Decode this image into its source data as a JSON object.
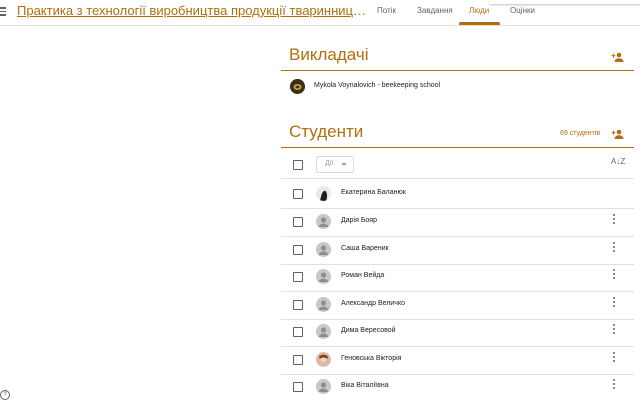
{
  "header": {
    "course_title": "Практика з технології виробництва продукції тваринництва (бджільництво)",
    "tabs": [
      {
        "label": "Потік"
      },
      {
        "label": "Завдання"
      },
      {
        "label": "Люди"
      },
      {
        "label": "Оцінки"
      }
    ],
    "active_tab": "Люди"
  },
  "teachers": {
    "title": "Викладачі",
    "items": [
      {
        "name": "Mykola Voynalovich - beekeeping school"
      }
    ]
  },
  "students": {
    "title": "Студенти",
    "count_label": "69 студентів",
    "actions_label": "Дії",
    "items": [
      {
        "name": "Екатерина Баланюк",
        "avatar": "photo-dark"
      },
      {
        "name": "Дарія Бояр",
        "avatar": "default"
      },
      {
        "name": "Саша Вареник",
        "avatar": "default"
      },
      {
        "name": "Роман Вейда",
        "avatar": "default"
      },
      {
        "name": "Александр Величко",
        "avatar": "default"
      },
      {
        "name": "Дима Вересовой",
        "avatar": "default"
      },
      {
        "name": "Геновська Вікторія",
        "avatar": "photo-red"
      },
      {
        "name": "Віка Віталіївна",
        "avatar": "default"
      }
    ]
  },
  "colors": {
    "accent": "#b06f0c",
    "divider": "#e0e0e0",
    "icon": "#5f6368"
  },
  "icons": {
    "menu": "menu-icon",
    "add_person": "person-add-icon",
    "sort": "sort-az-icon",
    "more": "more-vert-icon",
    "help": "help-icon"
  }
}
